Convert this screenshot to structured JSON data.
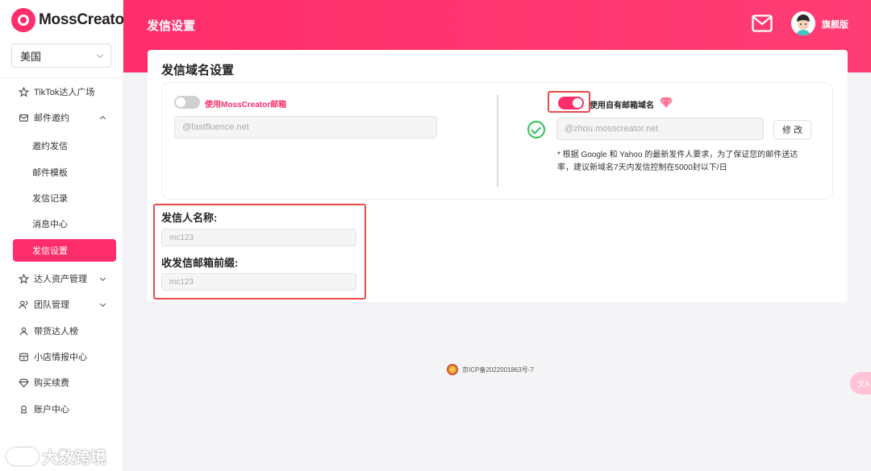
{
  "app": {
    "logo_text": "MossCreator",
    "region_selected": "美国"
  },
  "sidebar": {
    "items": [
      {
        "label": "TikTok达人广场",
        "icon": "star-icon"
      },
      {
        "label": "邮件邀约",
        "icon": "mail-icon"
      },
      {
        "label": "达人资产管理",
        "icon": "star-icon"
      },
      {
        "label": "团队管理",
        "icon": "users-icon"
      },
      {
        "label": "带货达人榜",
        "icon": "user-icon"
      },
      {
        "label": "小店情报中心",
        "icon": "shop-icon"
      },
      {
        "label": "购买续费",
        "icon": "diamond-icon"
      },
      {
        "label": "账户中心",
        "icon": "account-icon"
      }
    ],
    "mail_sub_items": [
      {
        "label": "邀约发信"
      },
      {
        "label": "邮件模板"
      },
      {
        "label": "发信记录"
      },
      {
        "label": "消息中心"
      },
      {
        "label": "发信设置",
        "active": true
      }
    ]
  },
  "header": {
    "title": "发信设置",
    "plan": "旗舰版"
  },
  "domain_settings": {
    "title": "发信域名设置",
    "option_moss": {
      "label": "使用MossCreator邮箱",
      "enabled": false,
      "domain_placeholder": "@fastfluence.net"
    },
    "option_own": {
      "label": "使用自有邮箱域名",
      "enabled": true,
      "domain_value": "@zhou.mosscreator.net",
      "edit_label": "修 改",
      "note": "* 根据 Google 和 Yahoo 的最新发件人要求，为了保证您的邮件送达率，建议新域名7天内发信控制在5000封以下/日"
    }
  },
  "sender": {
    "name_label": "发信人名称:",
    "name_value": "mc123",
    "prefix_label": "收发信邮箱前缀:",
    "prefix_value": "mc123"
  },
  "footer": {
    "icp": "京ICP备2022001863号-7"
  },
  "watermark": {
    "text": "大数跨境"
  },
  "float_button": {
    "label": "文A"
  },
  "colors": {
    "accent": "#ff2d6b",
    "success": "#2fbf5a",
    "annotation": "#e94b4b"
  }
}
